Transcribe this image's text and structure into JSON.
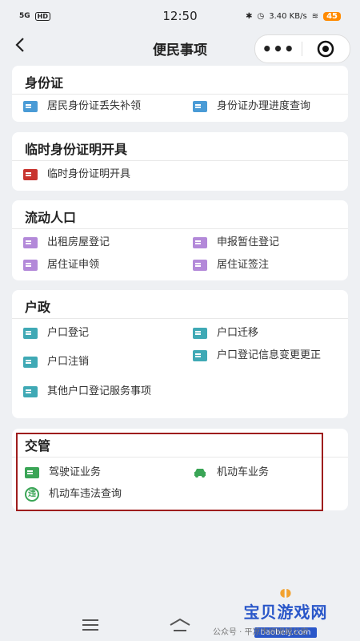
{
  "status": {
    "network": "5G",
    "hd": "HD",
    "time": "12:50",
    "speed": "3.40 KB/s",
    "battery": "45"
  },
  "nav": {
    "title": "便民事项"
  },
  "sections": {
    "id_card": {
      "title": "身份证",
      "item1": "居民身份证丢失补领",
      "item2": "身份证办理进度查询"
    },
    "temp_id": {
      "title": "临时身份证明开具",
      "item1": "临时身份证明开具"
    },
    "floating": {
      "title": "流动人口",
      "item1": "出租房屋登记",
      "item2": "申报暂住登记",
      "item3": "居住证申领",
      "item4": "居住证签注"
    },
    "household": {
      "title": "户政",
      "item1": "户口登记",
      "item2": "户口迁移",
      "item3": "户口注销",
      "item4": "户口登记信息变更更正",
      "item5": "其他户口登记服务事项"
    },
    "traffic": {
      "title": "交管",
      "item1": "驾驶证业务",
      "item2": "机动车业务",
      "item3": "机动车违法查询",
      "item3_icon_char": "违"
    }
  },
  "watermark": {
    "title": "宝贝游戏网",
    "url": "baobeiy.com",
    "footer": "公众号 · 平凉市崆峒城公安"
  },
  "colors": {
    "highlight": "#9e1d1d",
    "blue": "#4a9bd6",
    "red": "#c8332e",
    "purple": "#b389d9",
    "teal": "#3fa9b5",
    "green": "#3aa556"
  }
}
